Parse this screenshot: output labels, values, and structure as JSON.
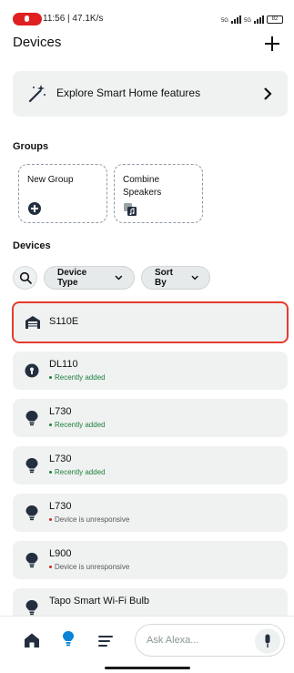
{
  "status_bar": {
    "time_speed": "11:56 | 47.1K/s",
    "sim1_label": "5G",
    "sim2_label": "5G",
    "battery": "82"
  },
  "header": {
    "title": "Devices",
    "add_icon": "plus-icon"
  },
  "explore": {
    "label": "Explore Smart Home features",
    "icon": "magic-wand-icon",
    "chevron": "chevron-right-icon"
  },
  "groups": {
    "section_title": "Groups",
    "items": [
      {
        "label": "New Group",
        "icon": "add-circle-icon"
      },
      {
        "label": "Combine\nSpeakers",
        "icon": "speaker-group-icon"
      }
    ]
  },
  "devices": {
    "section_title": "Devices",
    "filters": {
      "search_icon": "search-icon",
      "device_type_label": "Device Type",
      "sort_by_label": "Sort By"
    },
    "items": [
      {
        "name": "S110E",
        "status": "",
        "icon": "garage-icon",
        "selected": true
      },
      {
        "name": "DL110",
        "status": "Recently added",
        "icon": "lock-icon",
        "status_type": "added"
      },
      {
        "name": "L730",
        "status": "Recently added",
        "icon": "bulb-icon",
        "status_type": "added"
      },
      {
        "name": "L730",
        "status": "Recently added",
        "icon": "bulb-icon",
        "status_type": "added"
      },
      {
        "name": "L730",
        "status": "Device is unresponsive",
        "icon": "bulb-icon",
        "status_type": "unresponsive"
      },
      {
        "name": "L900",
        "status": "Device is unresponsive",
        "icon": "bulb-icon",
        "status_type": "unresponsive"
      },
      {
        "name": "Tapo Smart Wi-Fi Bulb",
        "status": "",
        "icon": "bulb-icon"
      }
    ]
  },
  "bottom_nav": {
    "ask_placeholder": "Ask Alexa...",
    "items": [
      "home-icon",
      "devices-bulb-icon",
      "more-icon"
    ],
    "active_color": "#0a84d6"
  },
  "colors": {
    "selected_outline": "#e63b2e",
    "recently_added": "#1e7f3a",
    "unresponsive_dot": "#d5251c"
  }
}
